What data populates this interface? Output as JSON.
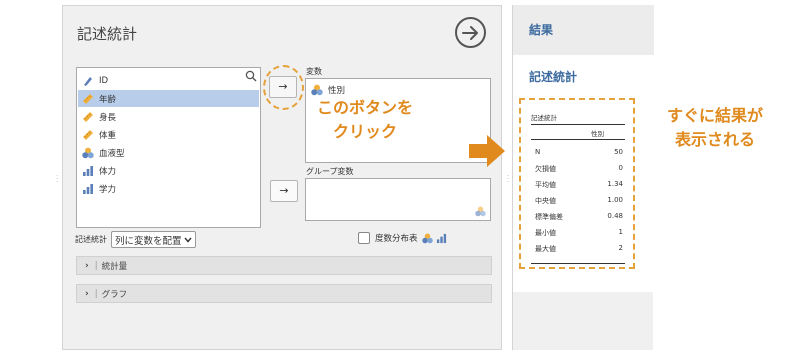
{
  "analysis": {
    "title": "記述統計",
    "variables": [
      {
        "label": "ID",
        "icon": "nominal-text-icon",
        "selected": false
      },
      {
        "label": "年齢",
        "icon": "continuous-ruler-icon",
        "selected": true
      },
      {
        "label": "身長",
        "icon": "continuous-ruler-icon",
        "selected": false
      },
      {
        "label": "体重",
        "icon": "continuous-ruler-icon",
        "selected": false
      },
      {
        "label": "血液型",
        "icon": "nominal-circles-icon",
        "selected": false
      },
      {
        "label": "体力",
        "icon": "ordinal-bars-icon",
        "selected": false
      },
      {
        "label": "学力",
        "icon": "ordinal-bars-icon",
        "selected": false
      }
    ],
    "move_label": "→",
    "variables_target_label": "変数",
    "variables_target_items": [
      "性別"
    ],
    "group_target_label": "グループ変数",
    "mode_label": "記述統計",
    "mode_value": "列に変数を配置",
    "freq_table_label": "度数分布表",
    "sections": [
      {
        "label": "統計量"
      },
      {
        "label": "グラフ"
      }
    ]
  },
  "results": {
    "header": "結果",
    "subtitle": "記述統計",
    "table": {
      "caption": "記述統計",
      "column": "性別",
      "rows": [
        {
          "label": "N",
          "value": "50"
        },
        {
          "label": "欠損値",
          "value": "0"
        },
        {
          "label": "平均値",
          "value": "1.34"
        },
        {
          "label": "中央値",
          "value": "1.00"
        },
        {
          "label": "標準偏差",
          "value": "0.48"
        },
        {
          "label": "最小値",
          "value": "1"
        },
        {
          "label": "最大値",
          "value": "2"
        }
      ]
    }
  },
  "annotations": {
    "button_note_line1": "このボタンを",
    "button_note_line2": "クリック",
    "result_note_line1": "すぐに結果が",
    "result_note_line2": "表示される"
  },
  "colors": {
    "accent_orange": "#e5a13a",
    "result_blue": "#3d6ba0",
    "selected_row": "#b7cdea"
  }
}
